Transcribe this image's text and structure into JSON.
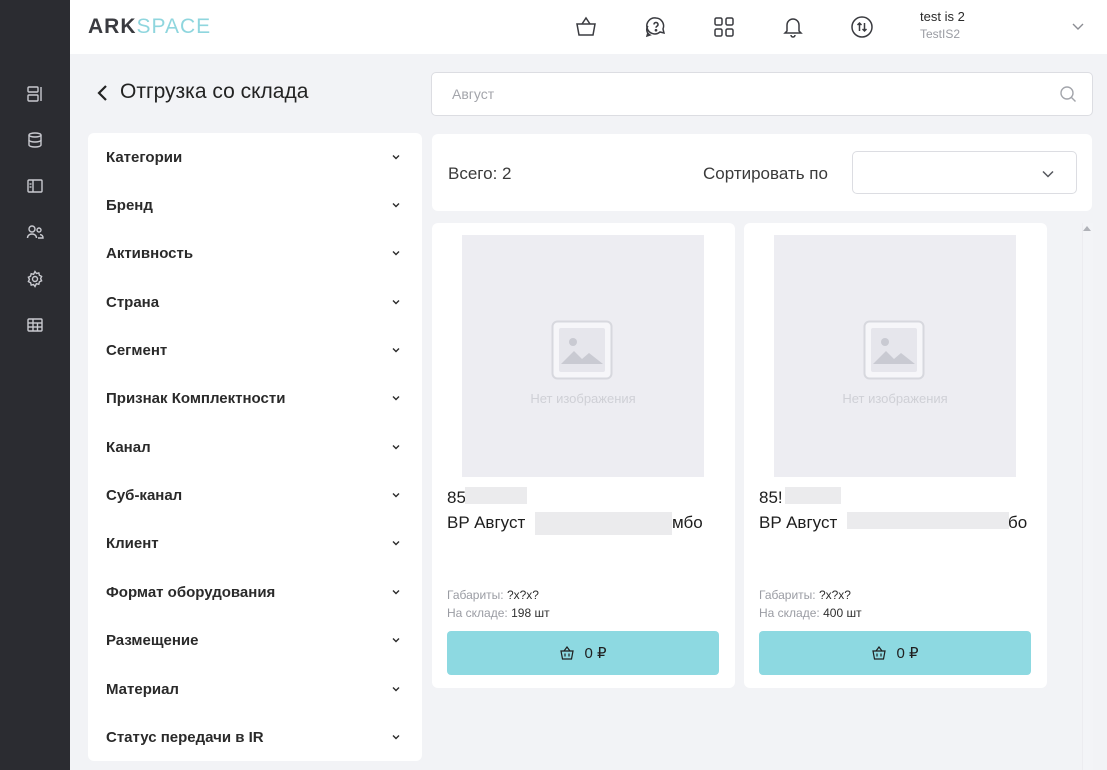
{
  "app": {
    "logo_part1": "ARK",
    "logo_part2": "SPACE"
  },
  "rail": {
    "icons": [
      "dashboard-icon",
      "database-icon",
      "catalog-icon",
      "users-icon",
      "settings-icon",
      "table-icon"
    ]
  },
  "header": {
    "icons": [
      "basket-icon",
      "support-chat-icon",
      "apps-grid-icon",
      "notifications-bell-icon",
      "exchange-icon"
    ],
    "user_name": "test is 2",
    "user_company": "TestIS2"
  },
  "page": {
    "title": "Отгрузка со склада"
  },
  "search": {
    "value": "",
    "placeholder": "Август"
  },
  "filters": [
    "Категории",
    "Бренд",
    "Активность",
    "Страна",
    "Сегмент",
    "Признак Комплектности",
    "Канал",
    "Суб-канал",
    "Клиент",
    "Формат оборудования",
    "Размещение",
    "Материал",
    "Статус передачи в IR"
  ],
  "results": {
    "total_label": "Всего: 2",
    "sort_label": "Сортировать по",
    "sort_value": ""
  },
  "products": [
    {
      "no_image": "Нет изображения",
      "code": "85",
      "name_start": "BP Август",
      "name_end": "мбо",
      "size_label": "Габариты:",
      "size_value": "?x?x?",
      "stock_label": "На складе:",
      "stock_value": "198 шт",
      "price": "0 ₽"
    },
    {
      "no_image": "Нет изображения",
      "code": "85!",
      "name_start": "BP Август",
      "name_end": "бо",
      "size_label": "Габариты:",
      "size_value": "?x?x?",
      "stock_label": "На складе:",
      "stock_value": "400 шт",
      "price": "0 ₽"
    }
  ],
  "colors": {
    "rail": "#2b2c31",
    "accent": "#8dd9e1",
    "logo_accent": "#8fd6de",
    "background": "#f2f3f6"
  }
}
